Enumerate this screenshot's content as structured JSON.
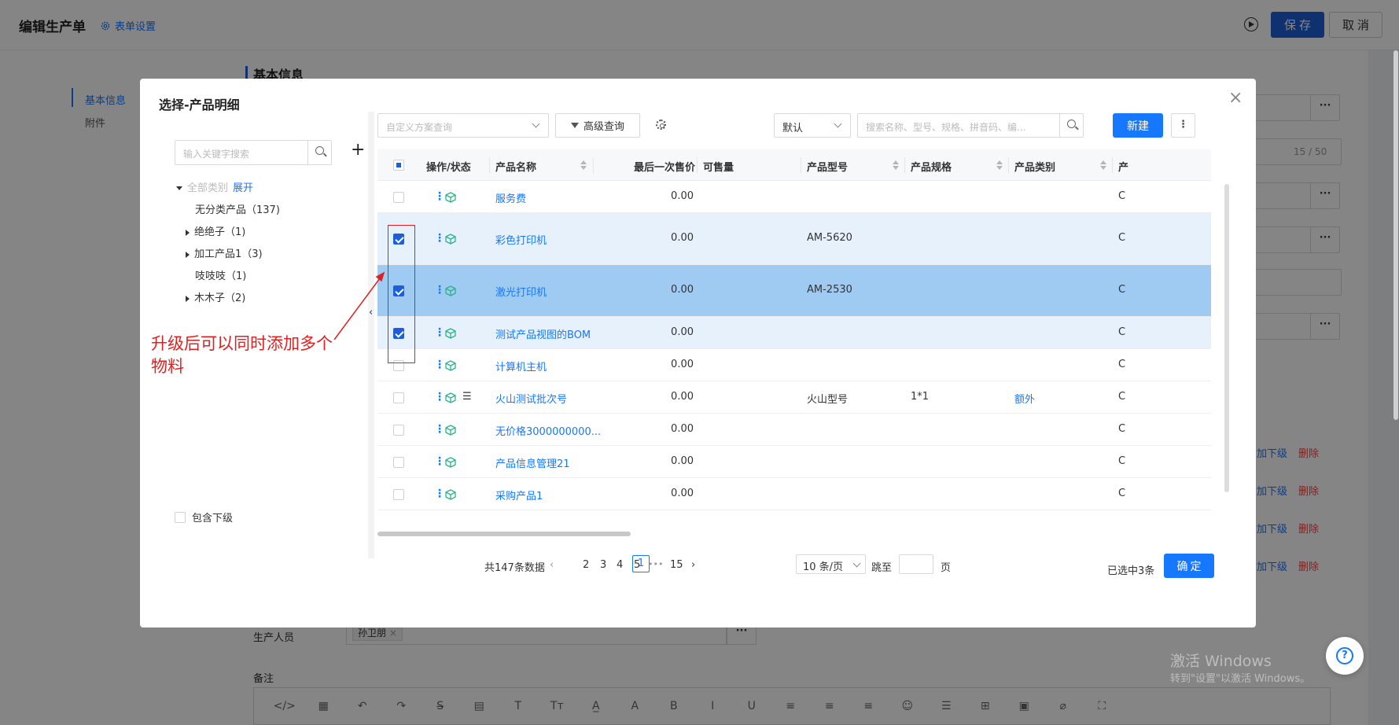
{
  "header": {
    "title": "编辑生产单",
    "form_settings": "表单设置",
    "save_label": "保存",
    "cancel_label": "取消"
  },
  "left_nav": [
    "基本信息",
    "附件"
  ],
  "form": {
    "section_title": "基本信息",
    "counter": "15 / 50",
    "row_add_label": "加下级",
    "row_delete_label": "删除",
    "staff_label": "生产人员",
    "staff_tag": "孙卫朋",
    "remark_label": "备注"
  },
  "editor_toolbar": [
    "</>",
    "▦",
    "↶",
    "↷",
    "S̶",
    "▤",
    "T",
    "Tт",
    "A̲",
    "A",
    "B",
    "I",
    "U",
    "≡",
    "≡",
    "≡",
    "☺",
    "☰",
    "⊞",
    "▣",
    "⌀",
    "⛶"
  ],
  "watermark": {
    "line1": "激活 Windows",
    "line2": "转到\"设置\"以激活 Windows。"
  },
  "modal": {
    "title": "选择-产品明细",
    "tree": {
      "search_placeholder": "输入关键字搜索",
      "root_label": "全部类别",
      "expand_label": "展开",
      "nodes": [
        {
          "label": "无分类产品（137)",
          "caret": "none"
        },
        {
          "label": "绝绝子（1)",
          "caret": "right"
        },
        {
          "label": "加工产品1（3)",
          "caret": "right"
        },
        {
          "label": "吱吱吱（1)",
          "caret": "none"
        },
        {
          "label": "木木子（2)",
          "caret": "right"
        }
      ],
      "include_sub_label": "包含下级"
    },
    "toolbar": {
      "scheme_placeholder": "自定义方案查询",
      "advanced_query": "高级查询",
      "sort_value": "默认",
      "search_placeholder": "搜索名称、型号、规格、拼音码、编...",
      "new_label": "新建"
    },
    "table": {
      "columns": [
        "操作/状态",
        "产品名称",
        "最后一次售价",
        "可售量",
        "产品型号",
        "产品规格",
        "产品类别",
        "产"
      ],
      "rows": [
        {
          "name": "服务费",
          "price": "0.00",
          "model": "",
          "spec": "",
          "category": "",
          "checked": false,
          "highlight": "none",
          "list_icon": false
        },
        {
          "name": "彩色打印机",
          "price": "0.00",
          "model": "AM-5620",
          "spec": "",
          "category": "",
          "checked": true,
          "highlight": "light",
          "list_icon": false
        },
        {
          "name": "激光打印机",
          "price": "0.00",
          "model": "AM-2530",
          "spec": "",
          "category": "",
          "checked": true,
          "highlight": "strong",
          "list_icon": false
        },
        {
          "name": "测试产品视图的BOM",
          "price": "0.00",
          "model": "",
          "spec": "",
          "category": "",
          "checked": true,
          "highlight": "light",
          "list_icon": false
        },
        {
          "name": "计算机主机",
          "price": "0.00",
          "model": "",
          "spec": "",
          "category": "",
          "checked": false,
          "highlight": "none",
          "list_icon": false
        },
        {
          "name": "火山测试批次号",
          "price": "0.00",
          "model": "火山型号",
          "spec": "1*1",
          "category": "额外",
          "checked": false,
          "highlight": "none",
          "list_icon": true
        },
        {
          "name": "无价格3000000000...",
          "price": "0.00",
          "model": "",
          "spec": "",
          "category": "",
          "checked": false,
          "highlight": "none",
          "list_icon": false
        },
        {
          "name": "产品信息管理21",
          "price": "0.00",
          "model": "",
          "spec": "",
          "category": "",
          "checked": false,
          "highlight": "none",
          "list_icon": false
        },
        {
          "name": "采购产品1",
          "price": "0.00",
          "model": "",
          "spec": "",
          "category": "",
          "checked": false,
          "highlight": "none",
          "list_icon": false
        }
      ]
    },
    "pagination": {
      "total": "共147条数据",
      "current": "1",
      "pages": [
        "2",
        "3",
        "4",
        "5"
      ],
      "ellipsis": "•••",
      "last": "15",
      "page_size": "10 条/页",
      "jump_label": "跳至",
      "page_unit": "页"
    },
    "selected_count": "已选中3条",
    "confirm_label": "确定"
  },
  "annotation": "升级后可以同时添加多个物料",
  "colors": {
    "primary": "#1677ff",
    "save_button": "#1d5fd6",
    "row_selected": "#9fcaf1",
    "row_selected_light": "#e6f1fc",
    "annotation": "#e02020"
  }
}
